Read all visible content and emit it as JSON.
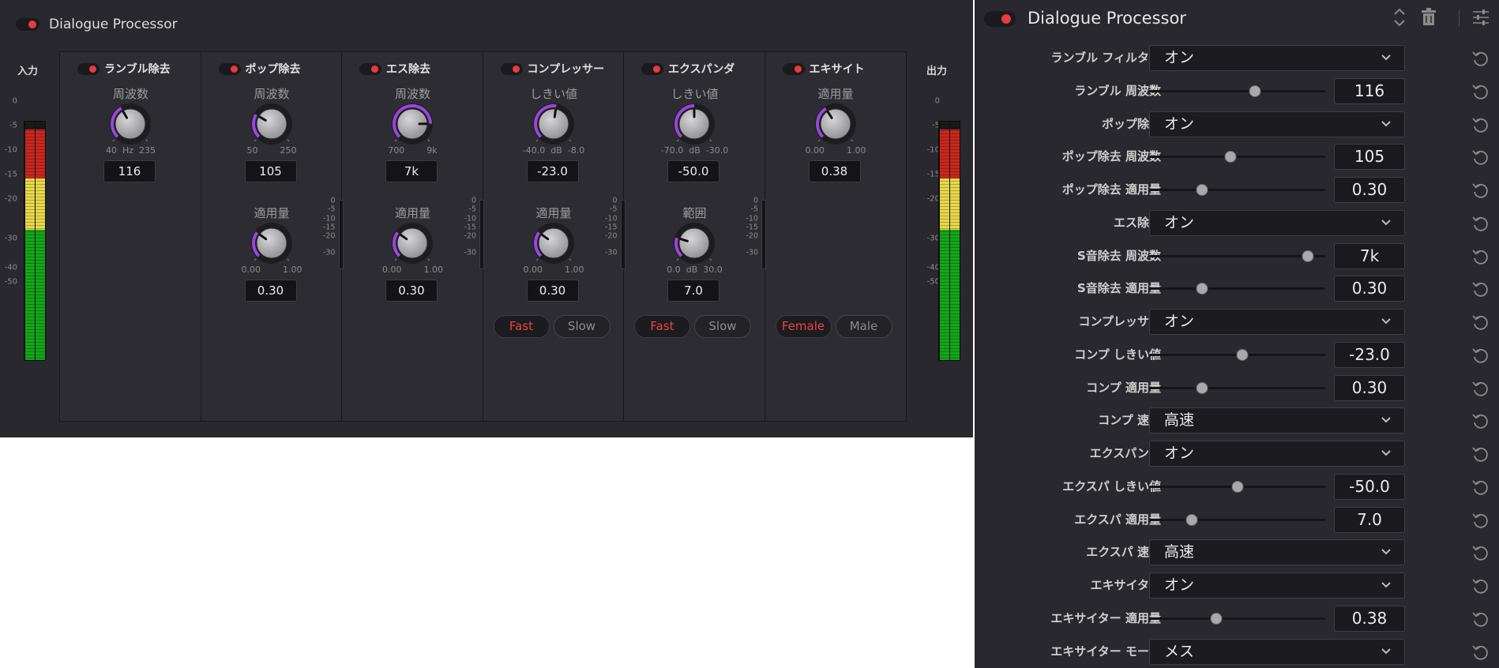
{
  "left_panel": {
    "title": "Dialogue Processor",
    "input_label": "入力",
    "output_label": "出力",
    "meter_scale": [
      "0",
      "-5",
      "-10",
      "-15",
      "-20",
      "-30",
      "-40",
      "-50"
    ],
    "gr_scale": [
      "0",
      "-5",
      "-10",
      "-15",
      "-20",
      "-30"
    ],
    "modules": [
      {
        "title": "ランブル除去",
        "knob1": {
          "label": "周波数",
          "min": "40",
          "unit": "Hz",
          "max": "235",
          "value": "116",
          "fraction": 0.39
        },
        "knob2": null,
        "buttons": null,
        "gr_meter": false
      },
      {
        "title": "ポップ除去",
        "knob1": {
          "label": "周波数",
          "min": "50",
          "unit": "",
          "max": "250",
          "value": "105",
          "fraction": 0.28
        },
        "knob2": {
          "label": "適用量",
          "min": "0.00",
          "unit": "",
          "max": "1.00",
          "value": "0.30",
          "fraction": 0.3
        },
        "buttons": null,
        "gr_meter": true
      },
      {
        "title": "エス除去",
        "knob1": {
          "label": "周波数",
          "min": "700",
          "unit": "",
          "max": "9k",
          "value": "7k",
          "fraction": 0.83
        },
        "knob2": {
          "label": "適用量",
          "min": "0.00",
          "unit": "",
          "max": "1.00",
          "value": "0.30",
          "fraction": 0.3
        },
        "buttons": null,
        "gr_meter": true
      },
      {
        "title": "コンプレッサー",
        "knob1": {
          "label": "しきい値",
          "min": "-40.0",
          "unit": "dB",
          "max": "-8.0",
          "value": "-23.0",
          "fraction": 0.53
        },
        "knob2": {
          "label": "適用量",
          "min": "0.00",
          "unit": "",
          "max": "1.00",
          "value": "0.30",
          "fraction": 0.3
        },
        "buttons": {
          "a": "Fast",
          "b": "Slow",
          "active": "a"
        },
        "gr_meter": true
      },
      {
        "title": "エクスパンダ",
        "knob1": {
          "label": "しきい値",
          "min": "-70.0",
          "unit": "dB",
          "max": "-30.0",
          "value": "-50.0",
          "fraction": 0.5
        },
        "knob2": {
          "label": "範囲",
          "min": "0.0",
          "unit": "dB",
          "max": "30.0",
          "value": "7.0",
          "fraction": 0.23
        },
        "buttons": {
          "a": "Fast",
          "b": "Slow",
          "active": "a"
        },
        "gr_meter": true
      },
      {
        "title": "エキサイト",
        "knob1": {
          "label": "適用量",
          "min": "0.00",
          "unit": "",
          "max": "1.00",
          "value": "0.38",
          "fraction": 0.38
        },
        "knob2": null,
        "buttons": {
          "a": "Female",
          "b": "Male",
          "active": "a"
        },
        "gr_meter": false
      }
    ]
  },
  "right_panel": {
    "title": "Dialogue Processor",
    "header_icons": [
      "updown-arrows-icon",
      "trash-icon",
      "sliders-icon"
    ],
    "rows": [
      {
        "label": "ランブル フィルター",
        "type": "dropdown",
        "value": "オン"
      },
      {
        "label": "ランブル 周波数",
        "type": "slider",
        "value": "116",
        "fraction": 0.6
      },
      {
        "label": "ポップ除去",
        "type": "dropdown",
        "value": "オン"
      },
      {
        "label": "ポップ除去 周波数",
        "type": "slider",
        "value": "105",
        "fraction": 0.46
      },
      {
        "label": "ポップ除去 適用量",
        "type": "slider",
        "value": "0.30",
        "fraction": 0.3
      },
      {
        "label": "エス除去",
        "type": "dropdown",
        "value": "オン"
      },
      {
        "label": "S音除去 周波数",
        "type": "slider",
        "value": "7k",
        "fraction": 0.9
      },
      {
        "label": "S音除去 適用量",
        "type": "slider",
        "value": "0.30",
        "fraction": 0.3
      },
      {
        "label": "コンプレッサー",
        "type": "dropdown",
        "value": "オン"
      },
      {
        "label": "コンプ しきい値",
        "type": "slider",
        "value": "-23.0",
        "fraction": 0.53
      },
      {
        "label": "コンプ 適用量",
        "type": "slider",
        "value": "0.30",
        "fraction": 0.3
      },
      {
        "label": "コンプ 速度",
        "type": "dropdown",
        "value": "高速"
      },
      {
        "label": "エクスパンダ",
        "type": "dropdown",
        "value": "オン"
      },
      {
        "label": "エクスパ しきい値",
        "type": "slider",
        "value": "-50.0",
        "fraction": 0.5
      },
      {
        "label": "エクスパ 適用量",
        "type": "slider",
        "value": "7.0",
        "fraction": 0.24
      },
      {
        "label": "エクスパ 速度",
        "type": "dropdown",
        "value": "高速"
      },
      {
        "label": "エキサイター",
        "type": "dropdown",
        "value": "オン"
      },
      {
        "label": "エキサイター 適用量",
        "type": "slider",
        "value": "0.38",
        "fraction": 0.38
      },
      {
        "label": "エキサイター モード",
        "type": "dropdown",
        "value": "メス"
      }
    ]
  },
  "colors": {
    "panel_bg": "#28282e",
    "accent_red": "#e83b3b",
    "knob_arc": "#9b45dc",
    "meter_red": "#c9271e",
    "meter_yellow": "#e8d84a",
    "meter_green": "#13a61a"
  }
}
